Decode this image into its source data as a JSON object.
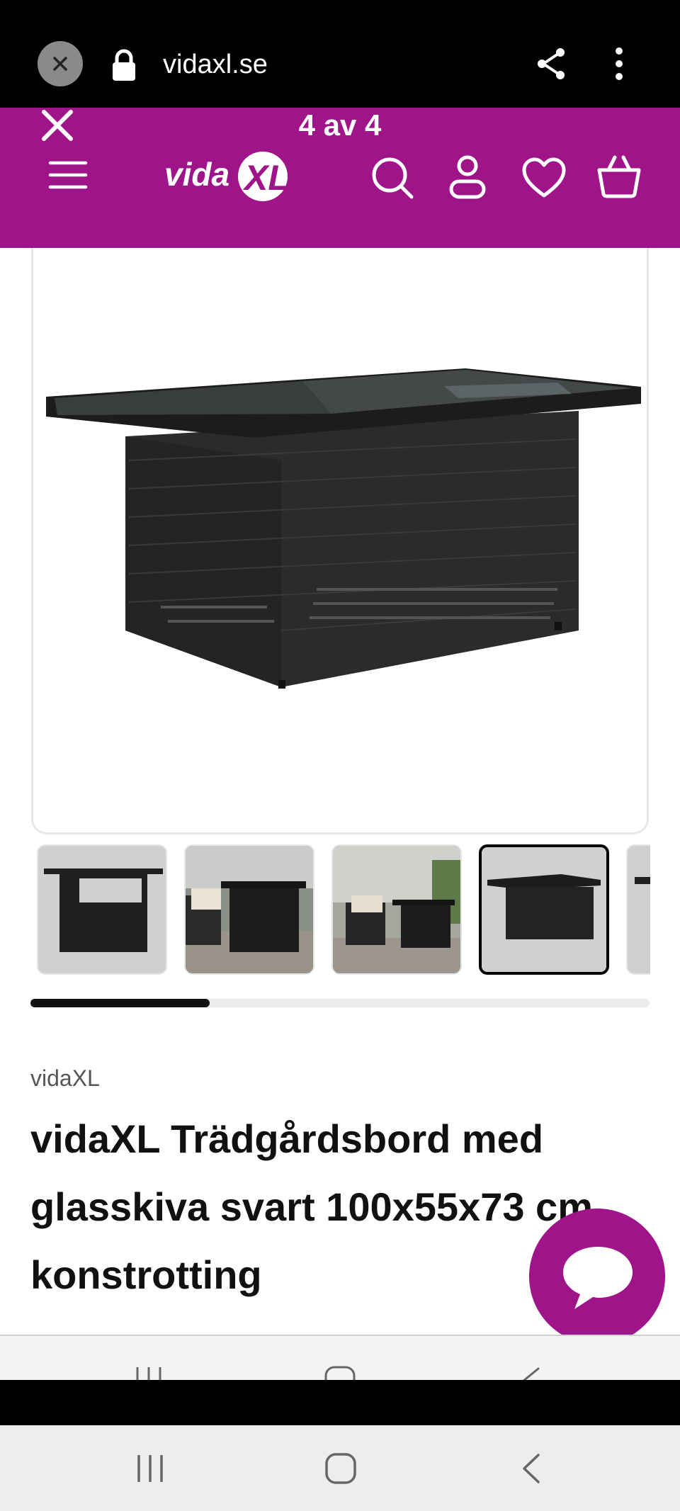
{
  "browser": {
    "url": "vidaxl.se",
    "icons": [
      "close-icon",
      "lock-icon",
      "share-icon",
      "more-vertical-icon"
    ]
  },
  "header": {
    "counter": "4 av 4",
    "logo_text": "vidaXL",
    "brand_color": "#a0148a",
    "icons": [
      "close-icon",
      "menu-icon",
      "search-icon",
      "account-icon",
      "heart-icon",
      "cart-icon"
    ]
  },
  "gallery": {
    "thumbnail_count": 5,
    "active_thumbnail": 4,
    "scroll_progress": 0.29
  },
  "product": {
    "brand": "vidaXL",
    "title": "vidaXL Trädgårdsbord med glasskiva svart 100x55x73 cm konstrotting"
  },
  "system_nav": {
    "buttons": [
      "recents-icon",
      "home-icon",
      "back-icon"
    ]
  }
}
